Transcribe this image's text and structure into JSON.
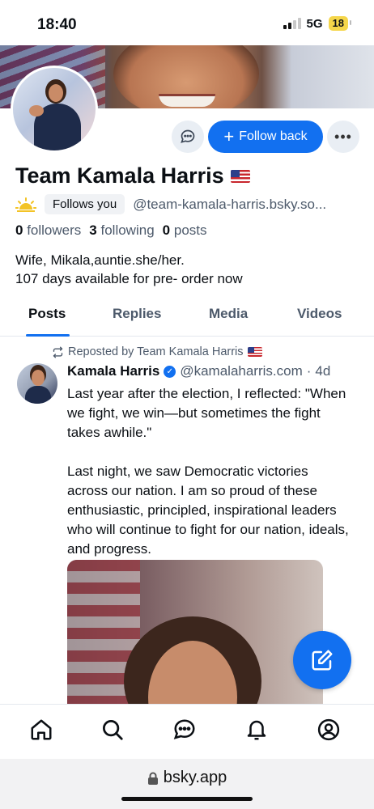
{
  "status_bar": {
    "time": "18:40",
    "network": "5G",
    "battery": "18"
  },
  "profile": {
    "display_name": "Team Kamala Harris",
    "follows_you": "Follows you",
    "handle": "@team-kamala-harris.bsky.so...",
    "followers_count": "0",
    "followers_label": "followers",
    "following_count": "3",
    "following_label": "following",
    "posts_count": "0",
    "posts_label": "posts",
    "bio_line1": "Wife, Mikala,auntie.she/her.",
    "bio_line2": "107 days available for pre- order now"
  },
  "actions": {
    "follow_back_label": "Follow back"
  },
  "tabs": [
    {
      "label": "Posts",
      "active": true
    },
    {
      "label": "Replies",
      "active": false
    },
    {
      "label": "Media",
      "active": false
    },
    {
      "label": "Videos",
      "active": false
    }
  ],
  "post": {
    "repost_label": "Reposted by Team Kamala Harris",
    "author": "Kamala Harris",
    "handle": "@kamalaharris.com",
    "separator": "·",
    "age": "4d",
    "text": "Last year after the election, I reflected: \"When we fight, we win—but sometimes the fight takes awhile.\"\n\nLast night, we saw Democratic victories across our nation. I am so proud of these enthusiastic, principled, inspirational leaders who will continue to fight for our nation, ideals, and progress."
  },
  "browser": {
    "url": "bsky.app"
  },
  "icons": {
    "chat": "chat-bubble-icon",
    "more": "ellipsis-icon",
    "compose": "compose-icon",
    "home": "home-icon",
    "search": "search-icon",
    "messages": "messages-icon",
    "notifications": "bell-icon",
    "profile": "profile-icon",
    "lock": "lock-icon",
    "repost": "repost-icon",
    "verified": "verified-check-icon"
  },
  "colors": {
    "accent": "#1270f0",
    "muted_text": "#4d5a6b",
    "battery": "#f5d64a"
  }
}
